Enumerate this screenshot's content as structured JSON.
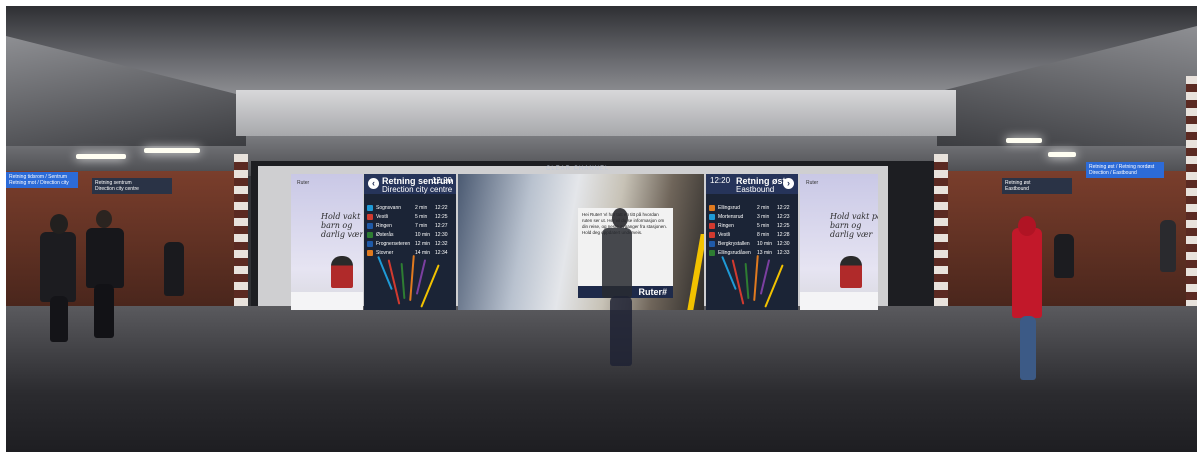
{
  "station": {
    "top_logo": "CLEAR CHANNEL"
  },
  "signs": {
    "left_blue": {
      "line1": "Retning tidsrom / Sentrum",
      "line2": "Retning mot / Direction city"
    },
    "left_dark": {
      "line1": "Retning sentrum",
      "line2": "Direction city centre"
    },
    "right_dark": {
      "line1": "Retning øst",
      "line2": "Eastbound"
    },
    "right_blue": {
      "line1": "Retning øst / Retning nordøst",
      "line2": "Direction / Eastbound"
    }
  },
  "ads": {
    "left": {
      "text": "Hold vakt på\nbarn og\ndarlig vær",
      "logo": "Ruter"
    },
    "right": {
      "text": "Hold vakt på\nbarn og\ndarlig vær",
      "logo": "Ruter"
    }
  },
  "departures_left": {
    "title": "Retning sentrum",
    "subtitle": "Direction city centre",
    "time": "12:20",
    "rows": [
      {
        "dest": "Sognsvann",
        "mins": "2 min",
        "clock": "12:22",
        "color": "#1f9ad6"
      },
      {
        "dest": "Vestli",
        "mins": "5 min",
        "clock": "12:25",
        "color": "#d23a2f"
      },
      {
        "dest": "Ringen",
        "mins": "7 min",
        "clock": "12:27",
        "color": "#1f5aa8"
      },
      {
        "dest": "Østerås",
        "mins": "10 min",
        "clock": "12:30",
        "color": "#2e7d32"
      },
      {
        "dest": "Frognerseteren",
        "mins": "12 min",
        "clock": "12:32",
        "color": "#1f5aa8"
      },
      {
        "dest": "Stovner",
        "mins": "14 min",
        "clock": "12:34",
        "color": "#e07a1f"
      }
    ]
  },
  "departures_right": {
    "title": "Retning øst",
    "subtitle": "Eastbound",
    "time": "12:20",
    "rows": [
      {
        "dest": "Ellingsrud",
        "mins": "2 min",
        "clock": "12:22",
        "color": "#e07a1f"
      },
      {
        "dest": "Mortensrud",
        "mins": "3 min",
        "clock": "12:23",
        "color": "#1f9ad6"
      },
      {
        "dest": "Ringen",
        "mins": "5 min",
        "clock": "12:25",
        "color": "#d23a2f"
      },
      {
        "dest": "Vestli",
        "mins": "8 min",
        "clock": "12:28",
        "color": "#d23a2f"
      },
      {
        "dest": "Bergkrystallen",
        "mins": "10 min",
        "clock": "12:30",
        "color": "#1f5aa8"
      },
      {
        "dest": "Ellingsrudåsen",
        "mins": "13 min",
        "clock": "12:33",
        "color": "#2e7d32"
      }
    ]
  },
  "info_card": {
    "text": "Hei Ruter! Vi har tatt en titt på hvordan ruten ser ut. Her vil du se informasjon om din reise, og neste avganger fra stasjonen. Hold deg oppdatert underveis.",
    "brand": "Ruter#"
  }
}
